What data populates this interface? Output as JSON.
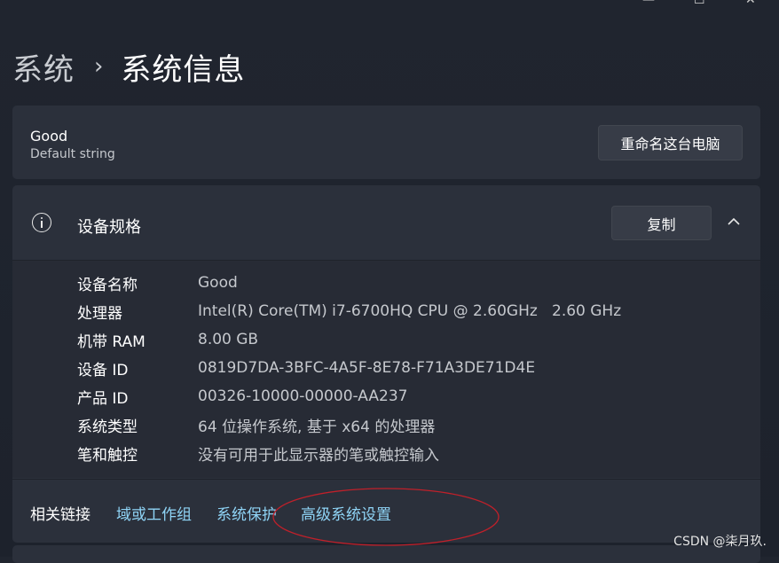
{
  "breadcrumb": {
    "parent": "系统",
    "separator": "›",
    "current": "系统信息"
  },
  "pc": {
    "name": "Good",
    "model": "Default string",
    "rename_label": "重命名这台电脑"
  },
  "spec": {
    "title": "设备规格",
    "copy_label": "复制",
    "rows": [
      {
        "key": "设备名称",
        "value": "Good"
      },
      {
        "key": "处理器",
        "value": "Intel(R) Core(TM) i7-6700HQ CPU @ 2.60GHz   2.60 GHz"
      },
      {
        "key": "机带 RAM",
        "value": "8.00 GB"
      },
      {
        "key": "设备 ID",
        "value": "0819D7DA-3BFC-4A5F-8E78-F71A3DE71D4E"
      },
      {
        "key": "产品 ID",
        "value": "00326-10000-00000-AA237"
      },
      {
        "key": "系统类型",
        "value": "64 位操作系统, 基于 x64 的处理器"
      },
      {
        "key": "笔和触控",
        "value": "没有可用于此显示器的笔或触控输入"
      }
    ]
  },
  "related": {
    "label": "相关链接",
    "links": [
      "域或工作组",
      "系统保护",
      "高级系统设置"
    ]
  },
  "watermark": "CSDN @柒月玖.",
  "colors": {
    "link": "#8fd4f6",
    "annotation": "#c0202a",
    "card": "#2b303b"
  }
}
